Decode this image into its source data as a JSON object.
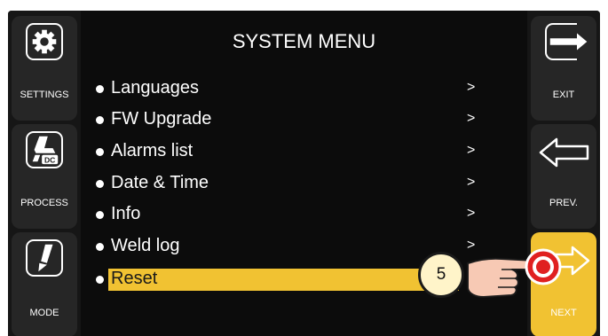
{
  "title": "SYSTEM MENU",
  "left_buttons": [
    {
      "label": "SETTINGS",
      "icon": "gear-icon"
    },
    {
      "label": "PROCESS",
      "icon": "torch-dc-icon",
      "badge": "DC"
    },
    {
      "label": "MODE",
      "icon": "torch-mode-icon"
    }
  ],
  "right_buttons": [
    {
      "label": "EXIT",
      "icon": "exit-arrow-icon"
    },
    {
      "label": "PREV.",
      "icon": "arrow-left-icon"
    },
    {
      "label": "NEXT",
      "icon": "arrow-right-icon"
    }
  ],
  "menu": {
    "items": [
      {
        "label": "Languages",
        "arrow": ">"
      },
      {
        "label": "FW Upgrade",
        "arrow": ">"
      },
      {
        "label": "Alarms list",
        "arrow": ">"
      },
      {
        "label": "Date & Time",
        "arrow": ">"
      },
      {
        "label": "Info",
        "arrow": ">"
      },
      {
        "label": "Weld log",
        "arrow": ">"
      },
      {
        "label": "Reset",
        "arrow": ""
      }
    ],
    "selected_index": 6
  },
  "callout": {
    "number": "5"
  },
  "colors": {
    "screen": "#0c0c0c",
    "panel": "#262626",
    "accent": "#f1c232",
    "text": "#ffffff",
    "touch": "#e02020"
  }
}
